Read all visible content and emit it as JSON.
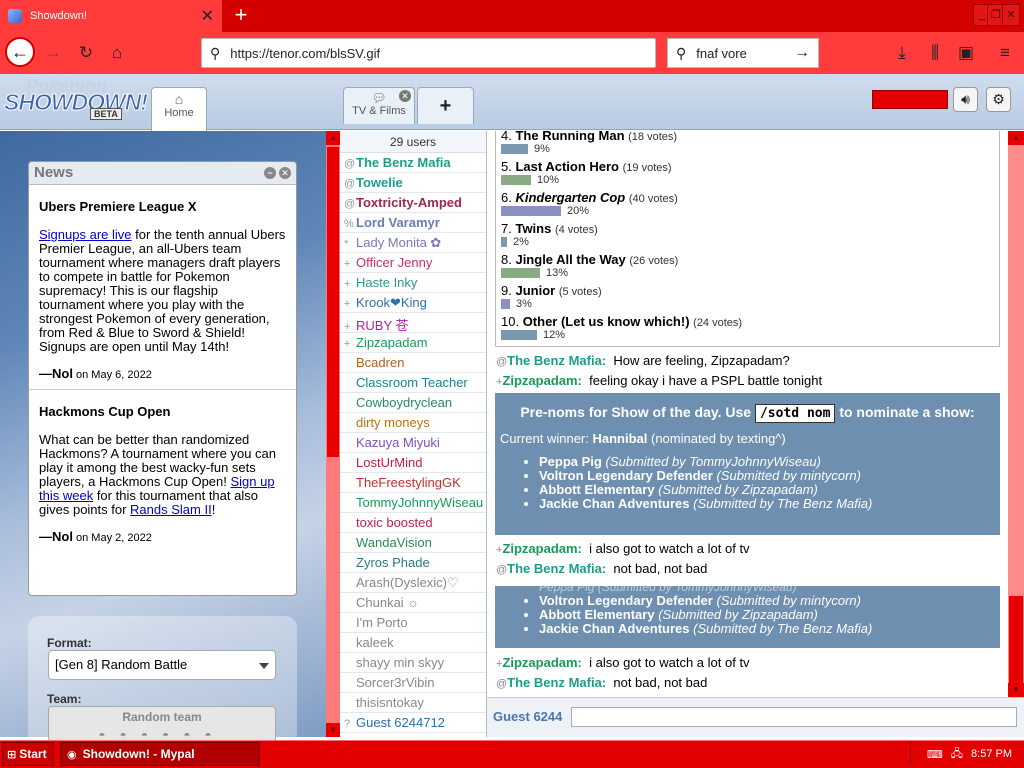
{
  "browser": {
    "tab_title": "Showdown!",
    "url": "https://tenor.com/blsSV.gif",
    "search_query": "fnaf vore"
  },
  "sd_tabs": {
    "home": "Home",
    "tv": "TV & Films"
  },
  "news": {
    "title": "News",
    "articles": [
      {
        "heading": "Ubers Premiere League X",
        "link1": "Signups are live",
        "body": " for the tenth annual Ubers Premier League, an all-Ubers team tournament where managers draft players to compete in battle for Pokemon supremacy! This is our flagship tournament where you play with the strongest Pokemon of every generation, from Red & Blue to Sword & Shield! Signups are open until May 14th!",
        "author": "—Nol",
        "date": " on May 6, 2022"
      },
      {
        "heading": "Hackmons Cup Open",
        "body_pre": "What can be better than randomized Hackmons? A tournament where you can play it among the best wacky-fun sets players, a Hackmons Cup Open! ",
        "link1": "Sign up this week",
        "body_mid": " for this tournament that also gives points for ",
        "link2": "Rands Slam II",
        "body_post": "!",
        "author": "—Nol",
        "date": " on May 2, 2022"
      }
    ]
  },
  "format": {
    "label": "Format:",
    "value": "[Gen 8] Random Battle",
    "team_label": "Team:",
    "team_value": "Random team"
  },
  "userlist": {
    "count": "29 users",
    "users": [
      {
        "rank": "@",
        "name": "The Benz Mafia",
        "color": "#1a9f8a",
        "bold": true
      },
      {
        "rank": "@",
        "name": "Towelie",
        "color": "#1a9f8a",
        "bold": true
      },
      {
        "rank": "@",
        "name": "Toxtricity-Amped",
        "color": "#a0284a",
        "bold": true
      },
      {
        "rank": "%",
        "name": "Lord Varamyr",
        "color": "#6a7bb8",
        "bold": true
      },
      {
        "rank": "*",
        "name": "Lady Monita ✿",
        "color": "#7a7ab8",
        "bold": false
      },
      {
        "rank": "+",
        "name": "Officer Jenny",
        "color": "#c0306a",
        "bold": false
      },
      {
        "rank": "+",
        "name": "Haste Inky",
        "color": "#2a9a8a",
        "bold": false
      },
      {
        "rank": "+",
        "name": "Krook❤King",
        "color": "#2a6fb0",
        "bold": false
      },
      {
        "rank": "+",
        "name": "RUBY 苍",
        "color": "#b020a0",
        "bold": false
      },
      {
        "rank": "+",
        "name": "Zipzapadam",
        "color": "#1a9a5a",
        "bold": false
      },
      {
        "rank": "",
        "name": "Bcadren",
        "color": "#b06020",
        "bold": false
      },
      {
        "rank": "",
        "name": "Classroom Teacher",
        "color": "#1a80a0",
        "bold": false
      },
      {
        "rank": "",
        "name": "Cowboydryclean",
        "color": "#2a8a60",
        "bold": false
      },
      {
        "rank": "",
        "name": "dirty moneys",
        "color": "#c07010",
        "bold": false
      },
      {
        "rank": "",
        "name": "Kazuya Miyuki",
        "color": "#7a50c0",
        "bold": false
      },
      {
        "rank": "",
        "name": "LostUrMind",
        "color": "#c02040",
        "bold": false
      },
      {
        "rank": "",
        "name": "TheFreestylingGK",
        "color": "#c03030",
        "bold": false
      },
      {
        "rank": "",
        "name": "TommyJohnnyWiseau",
        "color": "#1a9a5a",
        "bold": false
      },
      {
        "rank": "",
        "name": "toxic boosted",
        "color": "#c02050",
        "bold": false
      },
      {
        "rank": "",
        "name": "WandaVision",
        "color": "#2a8a50",
        "bold": false
      },
      {
        "rank": "",
        "name": "Zyros Phade",
        "color": "#2a7a80",
        "bold": false
      },
      {
        "rank": "",
        "name": "Arash(Dyslexic)♡",
        "color": "#888888",
        "bold": false
      },
      {
        "rank": "",
        "name": "Chunkai ☼",
        "color": "#888888",
        "bold": false
      },
      {
        "rank": "",
        "name": "I'm Porto",
        "color": "#888888",
        "bold": false
      },
      {
        "rank": "",
        "name": "kaleek",
        "color": "#888888",
        "bold": false
      },
      {
        "rank": "",
        "name": "shayy min skyy",
        "color": "#888888",
        "bold": false
      },
      {
        "rank": "",
        "name": "Sorcer3rVibin",
        "color": "#888888",
        "bold": false
      },
      {
        "rank": "",
        "name": "thisisntokay",
        "color": "#888888",
        "bold": false
      },
      {
        "rank": "?",
        "name": "Guest 6244712",
        "color": "#2a6fb0",
        "bold": false
      }
    ]
  },
  "poll": {
    "options": [
      {
        "num": "4.",
        "title": "The Running Man",
        "italic": false,
        "votes": "(18 votes)",
        "pct": "9%",
        "frac": 0.09,
        "color": "#7a98ae"
      },
      {
        "num": "5.",
        "title": "Last Action Hero",
        "italic": false,
        "votes": "(19 votes)",
        "pct": "10%",
        "frac": 0.1,
        "color": "#8aaa86"
      },
      {
        "num": "6.",
        "title": "Kindergarten Cop",
        "italic": true,
        "votes": "(40 votes)",
        "pct": "20%",
        "frac": 0.2,
        "color": "#8a90c0"
      },
      {
        "num": "7.",
        "title": "Twins",
        "italic": false,
        "votes": "(4 votes)",
        "pct": "2%",
        "frac": 0.02,
        "color": "#7a98ae"
      },
      {
        "num": "8.",
        "title": "Jingle All the Way",
        "italic": false,
        "votes": "(26 votes)",
        "pct": "13%",
        "frac": 0.13,
        "color": "#8aaa86"
      },
      {
        "num": "9.",
        "title": "Junior",
        "italic": false,
        "votes": "(5 votes)",
        "pct": "3%",
        "frac": 0.03,
        "color": "#8a90c0"
      },
      {
        "num": "10.",
        "title": "Other (Let us know which!)",
        "italic": false,
        "votes": "(24 votes)",
        "pct": "12%",
        "frac": 0.12,
        "color": "#7a98ae"
      }
    ]
  },
  "chat": {
    "msg1": {
      "rank": "@",
      "user": "The Benz Mafia:",
      "text": "How are feeling, Zipzapadam?",
      "color": "#1a9f8a"
    },
    "msg2": {
      "rank": "+",
      "user": "Zipzapadam:",
      "text": "feeling okay i have a PSPL battle tonight",
      "color": "#1a9a5a"
    },
    "sotd": {
      "pre": "Pre-noms for Show of the day. Use ",
      "cmd": "/sotd nom",
      "post": " to nominate a show:",
      "winner_label": "Current winner: ",
      "winner": "Hannibal",
      "winner_note": " (nominated by texting^)",
      "items": [
        {
          "show": "Peppa Pig",
          "by": "(Submitted by TommyJohnnyWiseau)"
        },
        {
          "show": "Voltron Legendary Defender",
          "by": "(Submitted by mintycorn)"
        },
        {
          "show": "Abbott Elementary",
          "by": "(Submitted by Zipzapadam)"
        },
        {
          "show": "Jackie Chan Adventures",
          "by": "(Submitted by The Benz Mafia)"
        }
      ]
    },
    "msg3": {
      "rank": "+",
      "user": "Zipzapadam:",
      "text": "i also got to watch a lot of tv",
      "color": "#1a9a5a"
    },
    "msg4": {
      "rank": "@",
      "user": "The Benz Mafia:",
      "text": "not bad, not bad",
      "color": "#1a9f8a"
    },
    "glitch_line": "Peppa Pig (Submitted by TommyJohnnyWiseau)",
    "username": "Guest 6244"
  },
  "taskbar": {
    "start": "Start",
    "task": "Showdown! - Mypal",
    "clock": "8:57 PM"
  },
  "colors": {
    "chrome_red": "#d40000",
    "sotd_blue": "#6e8fb0"
  }
}
